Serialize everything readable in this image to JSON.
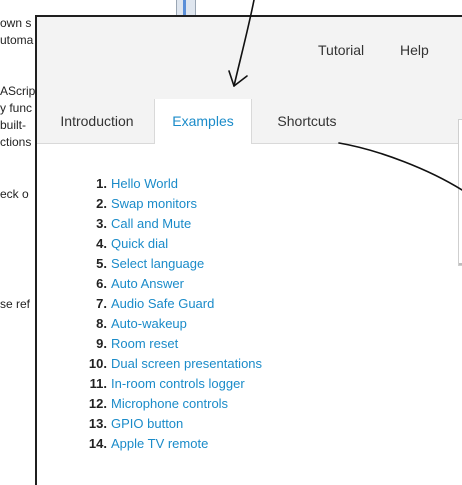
{
  "background_doc": {
    "lines": [
      "own s",
      "utoma",
      "AScrip",
      "y func",
      " built-",
      "ctions",
      "eck o",
      "se ref"
    ]
  },
  "header": {
    "tutorial_label": "Tutorial",
    "help_label": "Help"
  },
  "tabs": [
    {
      "label": "Introduction"
    },
    {
      "label": "Examples"
    },
    {
      "label": "Shortcuts"
    }
  ],
  "examples": [
    {
      "num": "1.",
      "label": "Hello World"
    },
    {
      "num": "2.",
      "label": "Swap monitors"
    },
    {
      "num": "3.",
      "label": "Call and Mute"
    },
    {
      "num": "4.",
      "label": "Quick dial"
    },
    {
      "num": "5.",
      "label": "Select language"
    },
    {
      "num": "6.",
      "label": "Auto Answer"
    },
    {
      "num": "7.",
      "label": "Audio Safe Guard"
    },
    {
      "num": "8.",
      "label": "Auto-wakeup"
    },
    {
      "num": "9.",
      "label": "Room reset"
    },
    {
      "num": "10.",
      "label": "Dual screen presentations"
    },
    {
      "num": "11.",
      "label": "In-room controls logger"
    },
    {
      "num": "12.",
      "label": "Microphone controls"
    },
    {
      "num": "13.",
      "label": "GPIO button"
    },
    {
      "num": "14.",
      "label": "Apple TV remote"
    }
  ],
  "colors": {
    "link": "#1a8bc9",
    "active_tab_text": "#1a8bc9",
    "header_bg": "#f3f3f3",
    "arrow": "#111111"
  }
}
